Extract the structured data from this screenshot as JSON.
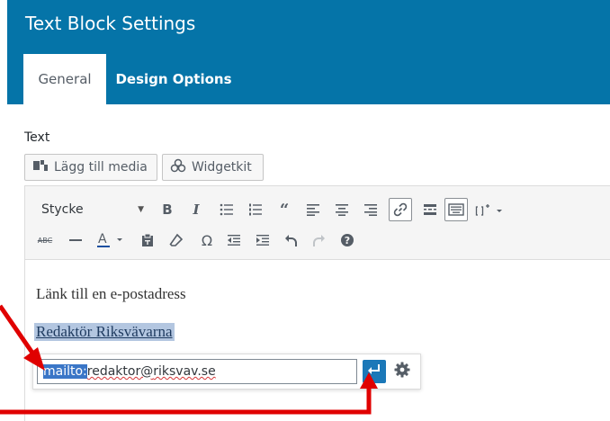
{
  "header": {
    "title": "Text Block Settings",
    "tabs": [
      {
        "label": "General",
        "active": true
      },
      {
        "label": "Design Options",
        "active": false
      }
    ]
  },
  "field_label": "Text",
  "media_buttons": {
    "add_media": "Lägg till media",
    "widgetkit": "Widgetkit"
  },
  "toolbar": {
    "format_select": "Stycke",
    "row1_icons": [
      "bold-icon",
      "italic-icon",
      "bullet-list-icon",
      "numbered-list-icon",
      "blockquote-icon",
      "align-left-icon",
      "align-center-icon",
      "align-right-icon",
      "link-icon",
      "read-more-icon",
      "toolbar-toggle-icon",
      "shortcode-icon"
    ],
    "row2_icons": [
      "strikethrough-icon",
      "horizontal-line-icon",
      "text-color-icon",
      "paste-text-icon",
      "clear-formatting-icon",
      "special-character-icon",
      "outdent-icon",
      "indent-icon",
      "undo-icon",
      "redo-icon",
      "help-icon"
    ],
    "active_icon": "link-icon",
    "text_color": "#1e50a0"
  },
  "content": {
    "paragraph": "Länk till en e-postadress",
    "link_text": "Redaktör Riksvävarna"
  },
  "link_popup": {
    "prefix_selected": "mailto:",
    "address_part1": "redaktor@",
    "address_part2": "riksvav.se"
  },
  "colors": {
    "header_bg": "#0574a8",
    "apply_button": "#1b78b8",
    "annotation": "#e00000",
    "selection": "#3a76c7"
  }
}
